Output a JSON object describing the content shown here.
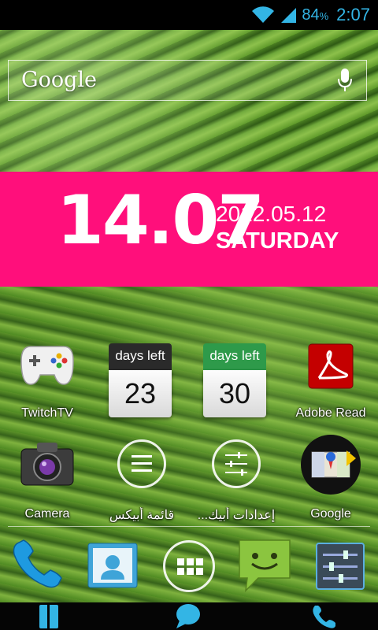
{
  "status": {
    "battery_value": "84",
    "battery_unit": "%",
    "time": "2:07",
    "accent": "#33b5e5"
  },
  "search": {
    "logo": "Google",
    "mic_icon": "microphone-icon"
  },
  "clock": {
    "time": "14.07",
    "date": "2012.05.12",
    "day": "SATURDAY",
    "band_color": "#ff0f7b"
  },
  "apps_row1": [
    {
      "label": "TwitchTV",
      "icon": "gamepad-icon"
    },
    {
      "header": "days left",
      "number": "23",
      "header_color": "#2a2a2a"
    },
    {
      "header": "days left",
      "number": "30",
      "header_color": "#2e9a4a"
    },
    {
      "label": "Adobe Read",
      "icon": "adobe-reader-icon"
    }
  ],
  "apps_row2": [
    {
      "label": "Camera",
      "icon": "camera-icon"
    },
    {
      "label": "قائمة أبيكس",
      "icon": "apex-menu-icon"
    },
    {
      "label": "إعدادات أبيك...",
      "icon": "apex-settings-icon"
    },
    {
      "label": "Google",
      "icon": "google-maps-icon"
    }
  ],
  "dock": [
    {
      "icon": "phone-icon"
    },
    {
      "icon": "contacts-icon"
    },
    {
      "icon": "app-drawer-icon"
    },
    {
      "icon": "messaging-icon"
    },
    {
      "icon": "settings-icon"
    }
  ],
  "navbar": [
    {
      "icon": "contacts-book-icon"
    },
    {
      "icon": "chat-bubble-icon"
    },
    {
      "icon": "phone-call-icon"
    }
  ]
}
